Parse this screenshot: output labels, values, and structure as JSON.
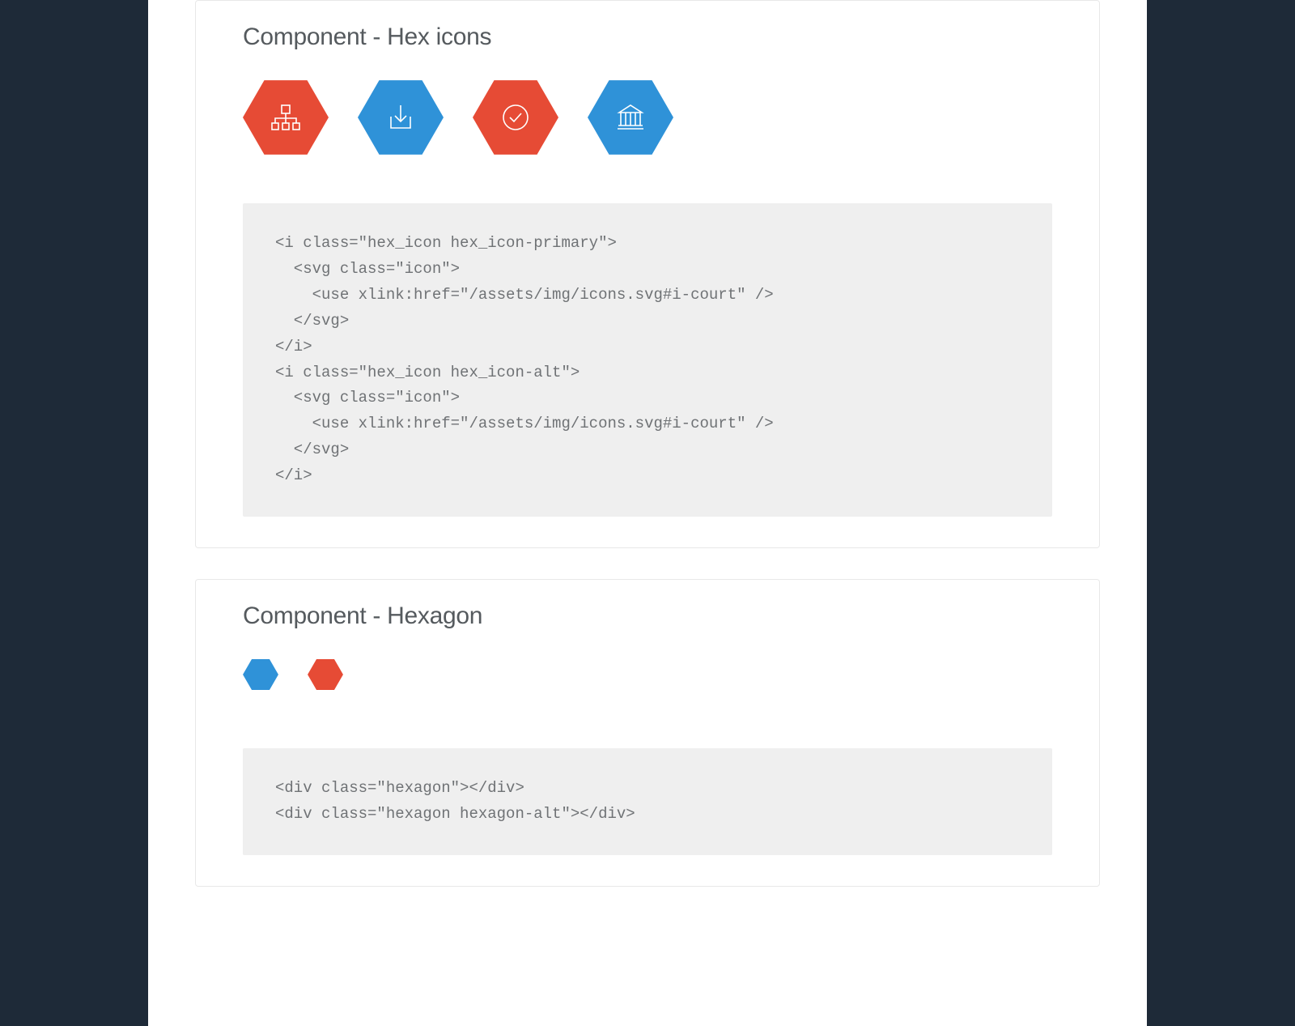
{
  "colors": {
    "primary": "#e64b35",
    "alt": "#2f92d8"
  },
  "sections": [
    {
      "title": "Component - Hex icons",
      "icons": [
        {
          "name": "sitemap-icon",
          "variant": "primary"
        },
        {
          "name": "download-icon",
          "variant": "alt"
        },
        {
          "name": "check-circle-icon",
          "variant": "primary"
        },
        {
          "name": "court-icon",
          "variant": "alt"
        }
      ],
      "code": "<i class=\"hex_icon hex_icon-primary\">\n  <svg class=\"icon\">\n    <use xlink:href=\"/assets/img/icons.svg#i-court\" />\n  </svg>\n</i>\n<i class=\"hex_icon hex_icon-alt\">\n  <svg class=\"icon\">\n    <use xlink:href=\"/assets/img/icons.svg#i-court\" />\n  </svg>\n</i>"
    },
    {
      "title": "Component - Hexagon",
      "shapes": [
        {
          "variant": "alt"
        },
        {
          "variant": "primary"
        }
      ],
      "code": "<div class=\"hexagon\"></div>\n<div class=\"hexagon hexagon-alt\"></div>"
    }
  ]
}
